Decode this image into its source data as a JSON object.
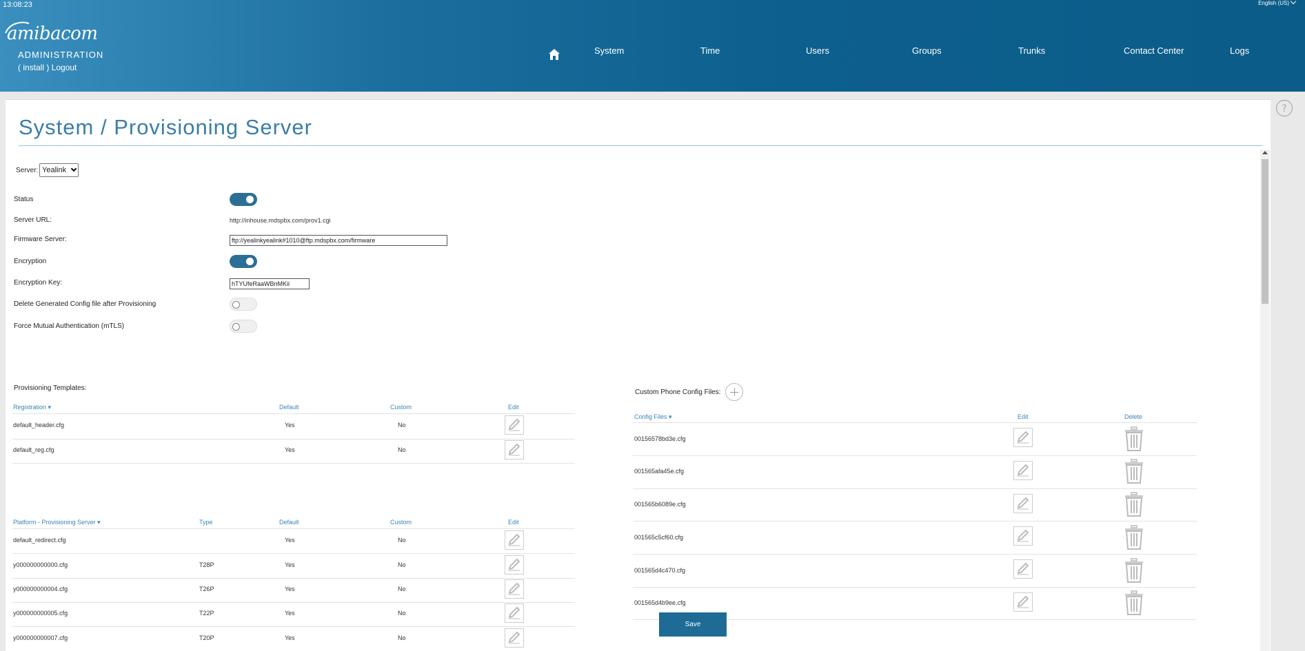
{
  "header": {
    "clock": "13:08:23",
    "language": "English (US)",
    "logo_text": "amibacom",
    "admin_label": "ADMINISTRATION",
    "install_label": "( install )",
    "logout_label": "Logout",
    "nav": [
      "System",
      "Time",
      "Users",
      "Groups",
      "Trunks",
      "Contact Center",
      "Logs"
    ]
  },
  "page": {
    "title": "System / Provisioning Server"
  },
  "settings": {
    "server_label": "Server:",
    "server_value": "Yealink",
    "status_label": "Status",
    "status_on": true,
    "server_url_label": "Server URL:",
    "server_url_value": "http://inhouse.mdspbx.com/prov1.cgi",
    "firmware_label": "Firmware Server:",
    "firmware_value": "ftp://yealinkyealink#1010@ftp.mdspbx.com/firmware",
    "encryption_label": "Encryption",
    "encryption_on": true,
    "encryption_key_label": "Encryption Key:",
    "encryption_key_value": "hTYUfeRaaWBnMKii",
    "delete_label": "Delete Generated Config file after Provisioning",
    "delete_on": false,
    "mtls_label": "Force Mutual Authentication (mTLS)",
    "mtls_on": false
  },
  "templates": {
    "section_label": "Provisioning Templates:",
    "reg_headers": {
      "name": "Registration ▾",
      "default": "Default",
      "custom": "Custom",
      "edit": "Edit"
    },
    "reg_rows": [
      {
        "name": "default_header.cfg",
        "default": "Yes",
        "custom": "No"
      },
      {
        "name": "default_reg.cfg",
        "default": "Yes",
        "custom": "No"
      }
    ],
    "platform_headers": {
      "name": "Platform - Provisioning Server ▾",
      "type": "Type",
      "default": "Default",
      "custom": "Custom",
      "edit": "Edit"
    },
    "platform_rows": [
      {
        "name": "default_redirect.cfg",
        "type": "",
        "default": "Yes",
        "custom": "No"
      },
      {
        "name": "y000000000000.cfg",
        "type": "T28P",
        "default": "Yes",
        "custom": "No"
      },
      {
        "name": "y000000000004.cfg",
        "type": "T26P",
        "default": "Yes",
        "custom": "No"
      },
      {
        "name": "y000000000005.cfg",
        "type": "T22P",
        "default": "Yes",
        "custom": "No"
      },
      {
        "name": "y000000000007.cfg",
        "type": "T20P",
        "default": "Yes",
        "custom": "No"
      }
    ]
  },
  "custom_files": {
    "section_label": "Custom Phone Config Files:",
    "headers": {
      "name": "Config Files ▾",
      "edit": "Edit",
      "delete": "Delete"
    },
    "rows": [
      "00156578bd3e.cfg",
      "001565afa45e.cfg",
      "001565b6089e.cfg",
      "001565c5cf60.cfg",
      "001565d4c470.cfg",
      "001565d4b9ee.cfg"
    ]
  },
  "actions": {
    "save_label": "Save"
  },
  "colors": {
    "accent": "#1e6b95",
    "header": "#0c5c89",
    "link": "#3a85b5"
  }
}
